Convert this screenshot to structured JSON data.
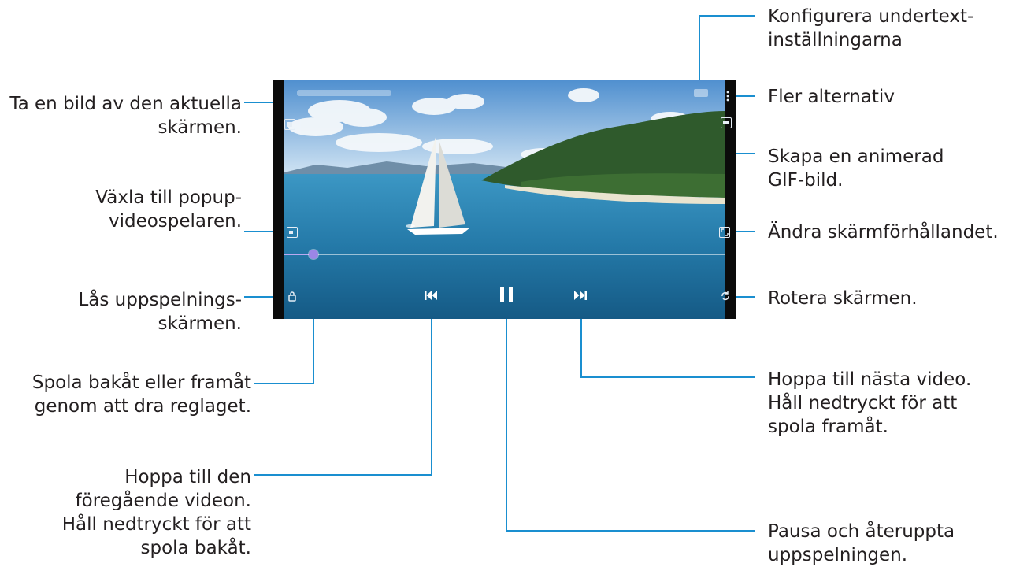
{
  "callouts": {
    "screenshot": [
      "Ta en bild av den aktuella",
      "skärmen."
    ],
    "popup": [
      "Växla till popup-",
      "videospelaren."
    ],
    "lock": [
      "Lås uppspelnings-",
      "skärmen."
    ],
    "seek": [
      "Spola bakåt eller framåt",
      "genom att dra reglaget."
    ],
    "previous": [
      "Hoppa till den",
      "föregående videon.",
      "Håll nedtryckt för att",
      "spola bakåt."
    ],
    "subtitles": [
      "Konfigurera undertext-",
      "inställningarna"
    ],
    "more": [
      "Fler alternativ"
    ],
    "gif": [
      "Skapa en animerad",
      "GIF-bild."
    ],
    "ratio": [
      "Ändra skärmförhållandet."
    ],
    "rotate": [
      "Rotera skärmen."
    ],
    "next": [
      "Hoppa till nästa video.",
      "Håll nedtryckt för att",
      "spola framåt."
    ],
    "pause": [
      "Pausa och återuppta",
      "uppspelningen."
    ]
  },
  "player": {
    "progress": 0.06,
    "icons": [
      "screenshot-icon",
      "popup-icon",
      "lock-icon",
      "previous-icon",
      "pause-icon",
      "next-icon",
      "rotate-icon",
      "aspect-ratio-icon",
      "gif-icon",
      "more-options-icon",
      "subtitles-icon"
    ]
  },
  "colors": {
    "callout_line": "#1a8fd0",
    "text": "#231f20",
    "seek_thumb": "#9b86e6"
  }
}
